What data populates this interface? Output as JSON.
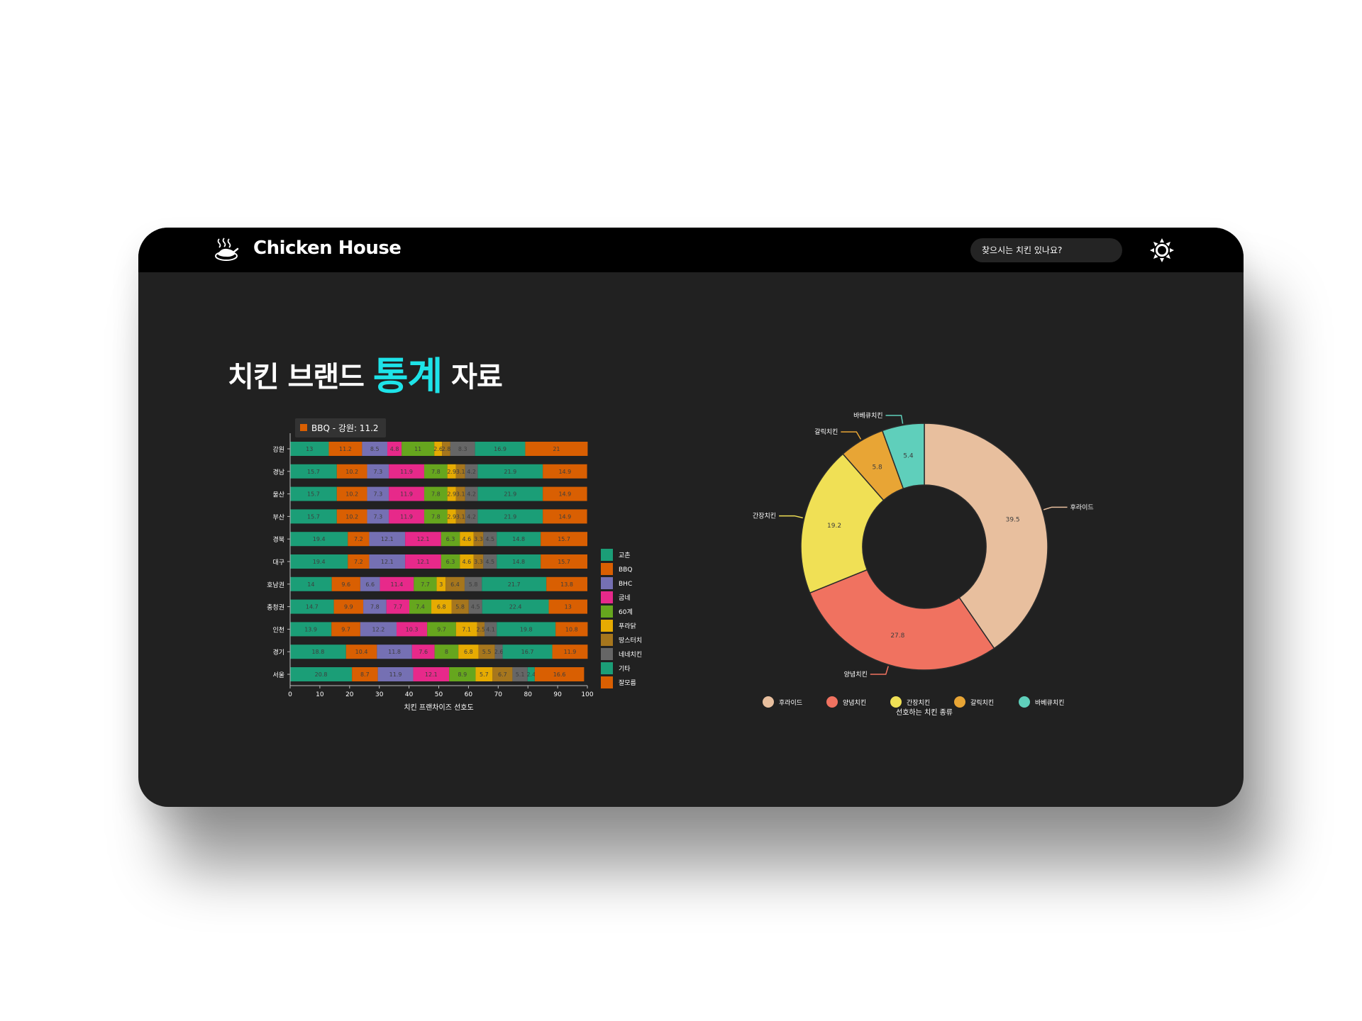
{
  "header": {
    "brand": "Chicken House",
    "search_placeholder": "찾으시는 치킨 있나요?"
  },
  "page": {
    "title_part1": "치킨 브랜드 ",
    "title_accent": "통계",
    "title_part2": " 자료"
  },
  "colors": {
    "accent": "#1ee3e8",
    "background": "#212121",
    "header": "#000000"
  },
  "icons": {
    "logo": "roast-chicken-icon",
    "theme": "sun-icon"
  },
  "chart_data": [
    {
      "type": "bar",
      "orientation": "horizontal",
      "stacked": true,
      "categories": [
        "강원",
        "경남",
        "울산",
        "부산",
        "경북",
        "대구",
        "호남권",
        "충청권",
        "인천",
        "경기",
        "서울"
      ],
      "series": [
        {
          "name": "교촌",
          "color": "#1b9e77",
          "values": [
            13,
            15.7,
            15.7,
            15.7,
            19.4,
            19.4,
            14,
            14.7,
            13.9,
            18.8,
            20.8
          ]
        },
        {
          "name": "BBQ",
          "color": "#d95f02",
          "values": [
            11.2,
            10.2,
            10.2,
            10.2,
            7.2,
            7.2,
            9.6,
            9.9,
            9.7,
            10.4,
            8.7
          ]
        },
        {
          "name": "BHC",
          "color": "#7570b3",
          "values": [
            8.5,
            7.3,
            7.3,
            7.3,
            12.1,
            12.1,
            6.6,
            7.8,
            12.2,
            11.8,
            11.9
          ]
        },
        {
          "name": "굽네",
          "color": "#e7298a",
          "values": [
            4.8,
            11.9,
            11.9,
            11.9,
            12.1,
            12.1,
            11.4,
            7.7,
            10.3,
            7.6,
            12.1
          ]
        },
        {
          "name": "60계",
          "color": "#66a61e",
          "values": [
            11,
            7.8,
            7.8,
            7.8,
            6.3,
            6.3,
            7.7,
            7.4,
            9.7,
            8,
            8.9
          ]
        },
        {
          "name": "푸라닭",
          "color": "#e6ab02",
          "values": [
            2.6,
            2.9,
            2.9,
            2.9,
            4.6,
            4.6,
            3,
            6.8,
            7.1,
            6.8,
            5.7
          ]
        },
        {
          "name": "땅스터치",
          "color": "#a6761d",
          "values": [
            2.8,
            3.1,
            3.1,
            3.1,
            3.3,
            3.3,
            6.4,
            5.8,
            2.5,
            5.5,
            6.7
          ]
        },
        {
          "name": "네네치킨",
          "color": "#666666",
          "values": [
            8.3,
            4.2,
            4.2,
            4.2,
            4.5,
            4.5,
            5.8,
            4.5,
            4.1,
            2.6,
            5.1
          ]
        },
        {
          "name": "기타",
          "color": "#1b9e77",
          "values": [
            16.9,
            21.9,
            21.9,
            21.9,
            14.8,
            14.8,
            21.7,
            22.4,
            19.8,
            16.7,
            2.4
          ]
        },
        {
          "name": "잘모름",
          "color": "#d95f02",
          "values": [
            21,
            14.9,
            14.9,
            14.9,
            15.7,
            15.7,
            13.8,
            13,
            10.8,
            11.9,
            16.6
          ]
        }
      ],
      "xlabel": "치킨 프랜차이즈 선호도",
      "ylabel": "",
      "xlim": [
        0,
        100
      ],
      "xticks": [
        0,
        10,
        20,
        30,
        40,
        50,
        60,
        70,
        80,
        90,
        100
      ],
      "legend_position": "right",
      "tooltip": {
        "text": "BBQ - 강원: 11.2",
        "color": "#d95f02"
      },
      "grid": false
    },
    {
      "type": "pie",
      "donut": true,
      "labels": [
        "후라이드",
        "양념치킨",
        "간장치킨",
        "갈릭치킨",
        "바베큐치킨"
      ],
      "values": [
        39.5,
        27.8,
        19.2,
        5.8,
        5.4
      ],
      "colors": [
        "#e8bf9e",
        "#f07260",
        "#f0e055",
        "#e8a535",
        "#5fcfbb"
      ],
      "xlabel": "선호하는 치킨 종류",
      "legend_position": "bottom"
    }
  ]
}
